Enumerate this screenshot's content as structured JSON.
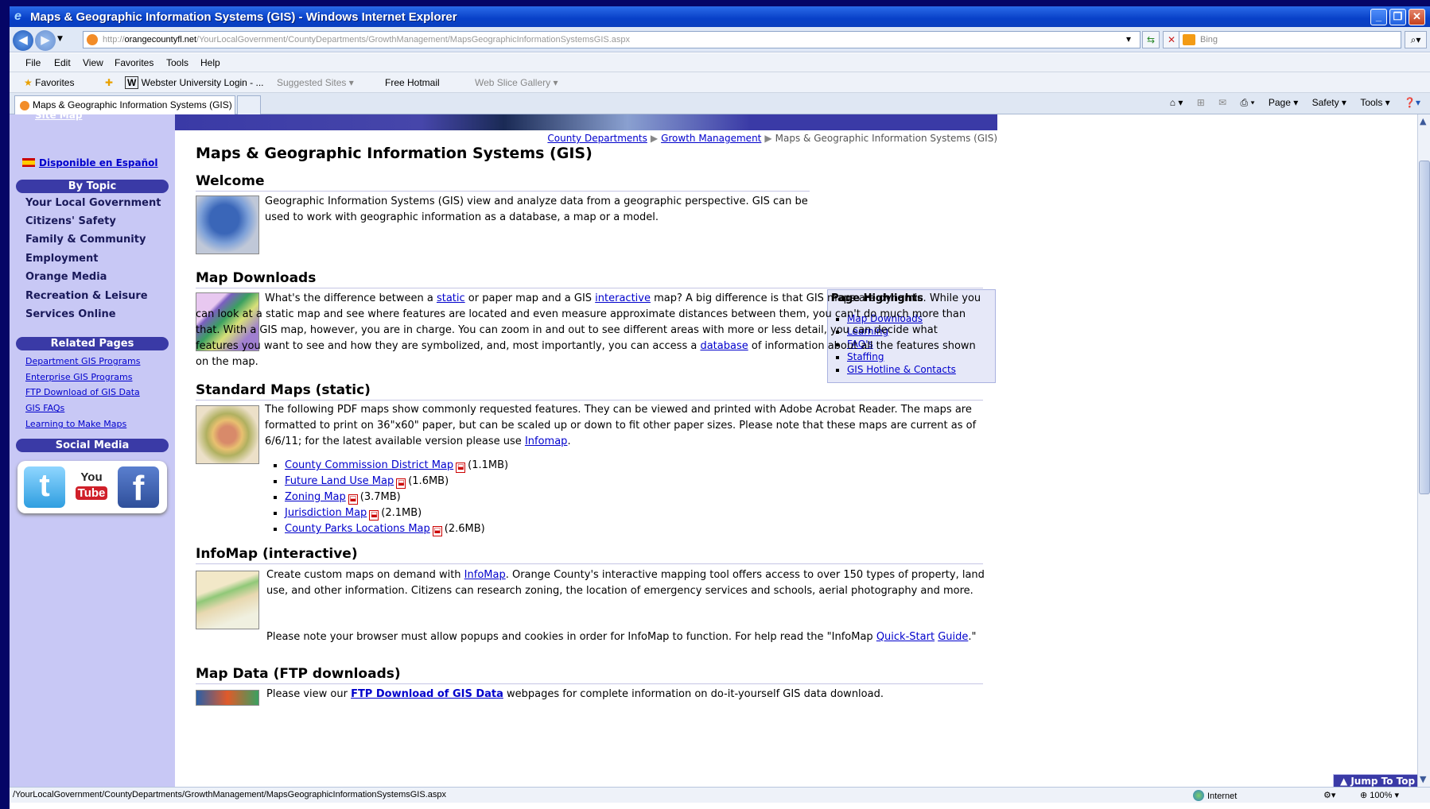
{
  "window": {
    "title": "Maps & Geographic Information Systems (GIS) - Windows Internet Explorer",
    "minimize": "_",
    "maximize": "❐",
    "close": "✕"
  },
  "addressbar": {
    "url_prefix": "http://",
    "url_host": "orangecountyfl.net",
    "url_path": "/YourLocalGovernment/CountyDepartments/GrowthManagement/MapsGeographicInformationSystemsGIS.aspx",
    "search_placeholder": "Bing"
  },
  "menu": [
    "File",
    "Edit",
    "View",
    "Favorites",
    "Tools",
    "Help"
  ],
  "favorites_bar": {
    "favorites_label": "Favorites",
    "items": [
      "Webster University Login - ...",
      "Suggested Sites ▾",
      "Free Hotmail",
      "Web Slice Gallery ▾"
    ]
  },
  "tab": {
    "label": "Maps & Geographic Information Systems (GIS)"
  },
  "commandbar": [
    "Page ▾",
    "Safety ▾",
    "Tools ▾"
  ],
  "leftnav": {
    "sitemap": "Site Map",
    "espanol": "Disponible en Español",
    "by_topic_header": "By Topic",
    "topics": [
      "Your Local Government",
      "Citizens' Safety",
      "Family & Community",
      "Employment",
      "Orange Media",
      "Recreation & Leisure",
      "Services Online"
    ],
    "related_header": "Related Pages",
    "related": [
      "Department GIS Programs",
      "Enterprise GIS Programs",
      "FTP Download of GIS Data",
      "GIS FAQs",
      "Learning to Make Maps"
    ],
    "social_header": "Social Media",
    "social": {
      "twitter": "t",
      "youtube_top": "You",
      "youtube_bottom": "Tube",
      "facebook": "f"
    }
  },
  "breadcrumb": [
    "County Departments",
    "Growth Management",
    "Maps & Geographic Information Systems (GIS)"
  ],
  "page": {
    "title": "Maps & Geographic Information Systems (GIS)",
    "welcome": {
      "heading": "Welcome",
      "text": "Geographic Information Systems (GIS) view and analyze data from a geographic perspective. GIS can be used to work with geographic information as a database, a map or a model."
    },
    "highlights": {
      "heading": "Page Highlights",
      "links": [
        "Map Downloads",
        "Learning",
        "FAQ's",
        "Staffing",
        "GIS Hotline & Contacts"
      ]
    },
    "map_downloads": {
      "heading": "Map Downloads",
      "t1": "What's the difference between a ",
      "link_static": "static",
      "t2": " or paper map and a GIS ",
      "link_interactive": "interactive",
      "t3": " map? A big difference is that GIS maps are dynamic. While you can look at a static map and see where features are located and even measure approximate distances between them, you can't do much more than that. With a GIS map, however, you are in charge. You can zoom in and out to see different areas with more or less detail, you can decide what features you want to see and how they are symbolized, and, most importantly, you can access a ",
      "link_database": "database",
      "t4": " of information about all the features shown on the map."
    },
    "standard_maps": {
      "heading": "Standard Maps (static)",
      "t1": "The following PDF maps show commonly requested features.  They can be viewed and printed with Adobe Acrobat Reader. The maps are formatted to print on 36\"x60\" paper, but can be scaled up or down to fit other paper sizes. Please note that these maps are current as of 6/6/11; for the latest available version please use ",
      "link_infomap": "Infomap",
      "t2": ".",
      "maps": [
        {
          "name": "County Commission District Map",
          "size": "(1.1MB)"
        },
        {
          "name": "Future Land Use Map",
          "size": "(1.6MB)"
        },
        {
          "name": "Zoning Map",
          "size": "(3.7MB)"
        },
        {
          "name": "Jurisdiction Map",
          "size": "(2.1MB)"
        },
        {
          "name": "County Parks Locations Map",
          "size": "(2.6MB)"
        }
      ]
    },
    "infomap": {
      "heading": "InfoMap (interactive)",
      "t1": "Create custom maps on demand with ",
      "link_infomap": "InfoMap",
      "t2": ". Orange County's interactive mapping tool offers access to over 150 types of property, land use, and other information. Citizens can research zoning, the location of emergency services and schools, aerial photography and more.",
      "note1": "Please note your browser must allow popups and cookies in order for InfoMap to function. For help read the \"InfoMap ",
      "link_quickstart_a": "Quick-Start",
      "link_quickstart_b": "Guide",
      "note2": ".\""
    },
    "map_data": {
      "heading": "Map Data (FTP downloads)",
      "t1": "Please view our ",
      "link_ftp": "FTP Download of GIS Data",
      "t2": " webpages for complete information on do-it-yourself GIS data download."
    },
    "jump_to_top": "▲ Jump To Top"
  },
  "statusbar": {
    "url": "/YourLocalGovernment/CountyDepartments/GrowthManagement/MapsGeographicInformationSystemsGIS.aspx",
    "zone": "Internet",
    "zoom": "100%"
  },
  "colors": {
    "nav_bg": "#c8c8f5",
    "nav_header": "#3a3aa6",
    "link": "#0000cc",
    "titlebar": "#0840c8"
  }
}
